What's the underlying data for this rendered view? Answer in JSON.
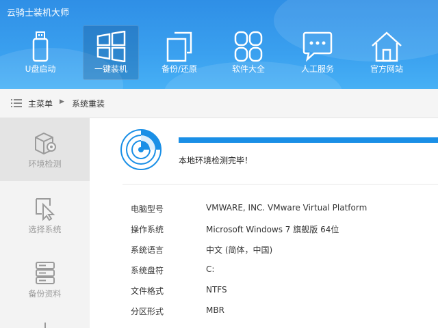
{
  "app": {
    "title": "云骑士装机大师"
  },
  "nav": {
    "items": [
      {
        "label": "U盘启动",
        "icon": "usb-drive-icon"
      },
      {
        "label": "一键装机",
        "icon": "windows-logo-icon"
      },
      {
        "label": "备份/还原",
        "icon": "copy-icon"
      },
      {
        "label": "软件大全",
        "icon": "apps-grid-icon"
      },
      {
        "label": "人工服务",
        "icon": "chat-icon"
      },
      {
        "label": "官方网站",
        "icon": "home-icon"
      }
    ],
    "active_index": 1
  },
  "breadcrumb": {
    "home": "主菜单",
    "current": "系统重装"
  },
  "sidebar": {
    "items": [
      {
        "label": "环境检测",
        "icon": "env-check-icon"
      },
      {
        "label": "选择系统",
        "icon": "cursor-select-icon"
      },
      {
        "label": "备份资料",
        "icon": "server-backup-icon"
      }
    ],
    "active_index": 0
  },
  "main": {
    "progress": 1.0,
    "status": "本地环境检测完毕！",
    "info": [
      {
        "label": "电脑型号",
        "value": "VMWARE, INC. VMware Virtual Platform"
      },
      {
        "label": "操作系统",
        "value": "Microsoft Windows 7 旗舰版  64位"
      },
      {
        "label": "系统语言",
        "value": "中文 (简体，中国)"
      },
      {
        "label": "系统盘符",
        "value": "C:"
      },
      {
        "label": "文件格式",
        "value": "NTFS"
      },
      {
        "label": "分区形式",
        "value": "MBR"
      }
    ]
  },
  "colors": {
    "header_top": "#2f8fe6",
    "header_bottom": "#47b0f5",
    "accent": "#1a8fe6",
    "sidebar_bg": "#f3f3f3",
    "sidebar_active": "#e4e4e4"
  }
}
